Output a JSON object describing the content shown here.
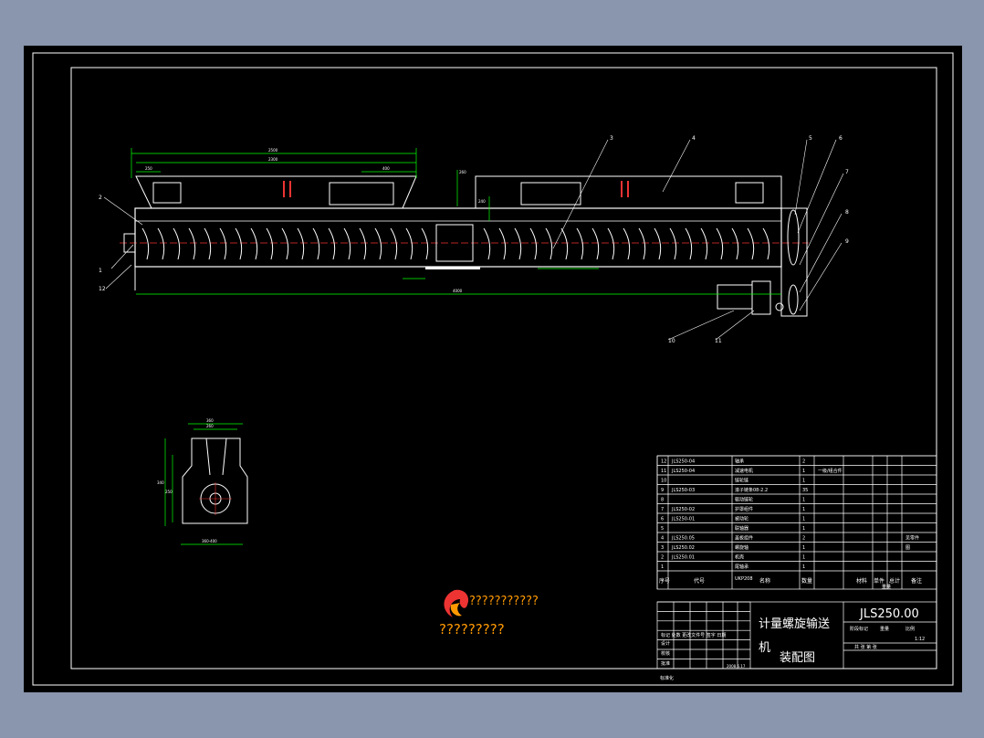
{
  "drawing": {
    "number": "JLS250.00",
    "title_line1": "计量螺旋输送",
    "title_line2": "机",
    "subtitle": "装配图",
    "scale": "1:12",
    "scale_text": "1:12"
  },
  "watermark": {
    "line1": "???????????",
    "line2": "?????????"
  },
  "parts_header": {
    "seq": "序号",
    "code": "代号",
    "name": "名称",
    "qty": "数量",
    "material": "材料",
    "unit_weight": "单件",
    "total_weight": "总计",
    "weight": "重量",
    "remark": "备注"
  },
  "parts": [
    {
      "no": "12",
      "code": "JLS250-04",
      "name": "轴承",
      "qty": "2",
      "material": "",
      "remark": ""
    },
    {
      "no": "11",
      "code": "JLS250-04",
      "name": "减速电机",
      "qty": "1",
      "material": "一级/组合件",
      "remark": ""
    },
    {
      "no": "10",
      "code": "",
      "name": "链轮链",
      "qty": "1",
      "material": "",
      "remark": ""
    },
    {
      "no": "9",
      "code": "JLS250-03",
      "name": "滚子链条08-2.2",
      "qty": "35",
      "material": "",
      "remark": ""
    },
    {
      "no": "8",
      "code": "",
      "name": "驱动链轮",
      "qty": "1",
      "material": "",
      "remark": ""
    },
    {
      "no": "7",
      "code": "JLS250-02",
      "name": "护罩组件",
      "qty": "1",
      "material": "",
      "remark": ""
    },
    {
      "no": "6",
      "code": "JLS250-01",
      "name": "被动轮",
      "qty": "1",
      "material": "",
      "remark": ""
    },
    {
      "no": "5",
      "code": "",
      "name": "联轴器",
      "qty": "1",
      "material": "",
      "remark": ""
    },
    {
      "no": "4",
      "code": "JLS250.05",
      "name": "盖板组件",
      "qty": "2",
      "material": "",
      "remark": "见零件"
    },
    {
      "no": "3",
      "code": "JLS250.02",
      "name": "螺旋轴",
      "qty": "1",
      "material": "",
      "remark": "图"
    },
    {
      "no": "2",
      "code": "JLS250.01",
      "name": "机壳",
      "qty": "1",
      "material": "",
      "remark": ""
    },
    {
      "no": "1",
      "code": "",
      "name": "尾轴承",
      "qty": "1",
      "material": "",
      "remark": ""
    }
  ],
  "parts_extra": {
    "code_small": "UKP208"
  },
  "title_block": {
    "rev_label": "标记 处数 更改文件号 签字 日期",
    "design": "设计",
    "check": "校核",
    "craft": "工艺",
    "approve": "批准",
    "stage": "阶段标记",
    "weight": "重量",
    "ratio": "比例",
    "sheet_count": "共 张 第 张",
    "standard": "标准化",
    "date_val": "2008.6.17"
  },
  "callouts": [
    "1",
    "2",
    "3",
    "4",
    "5",
    "6",
    "7",
    "8",
    "9",
    "10",
    "11",
    "12"
  ],
  "dimensions": {
    "overall_top": "2500",
    "inner_top": "2300",
    "left_segment": "250",
    "middle_segment": "400",
    "height_right": "260",
    "height_mid": "240",
    "total_length": "4000",
    "side_width_top": "360",
    "side_width_inner": "260",
    "side_height": "340",
    "side_height_inner": "250",
    "side_base": "360-400"
  }
}
